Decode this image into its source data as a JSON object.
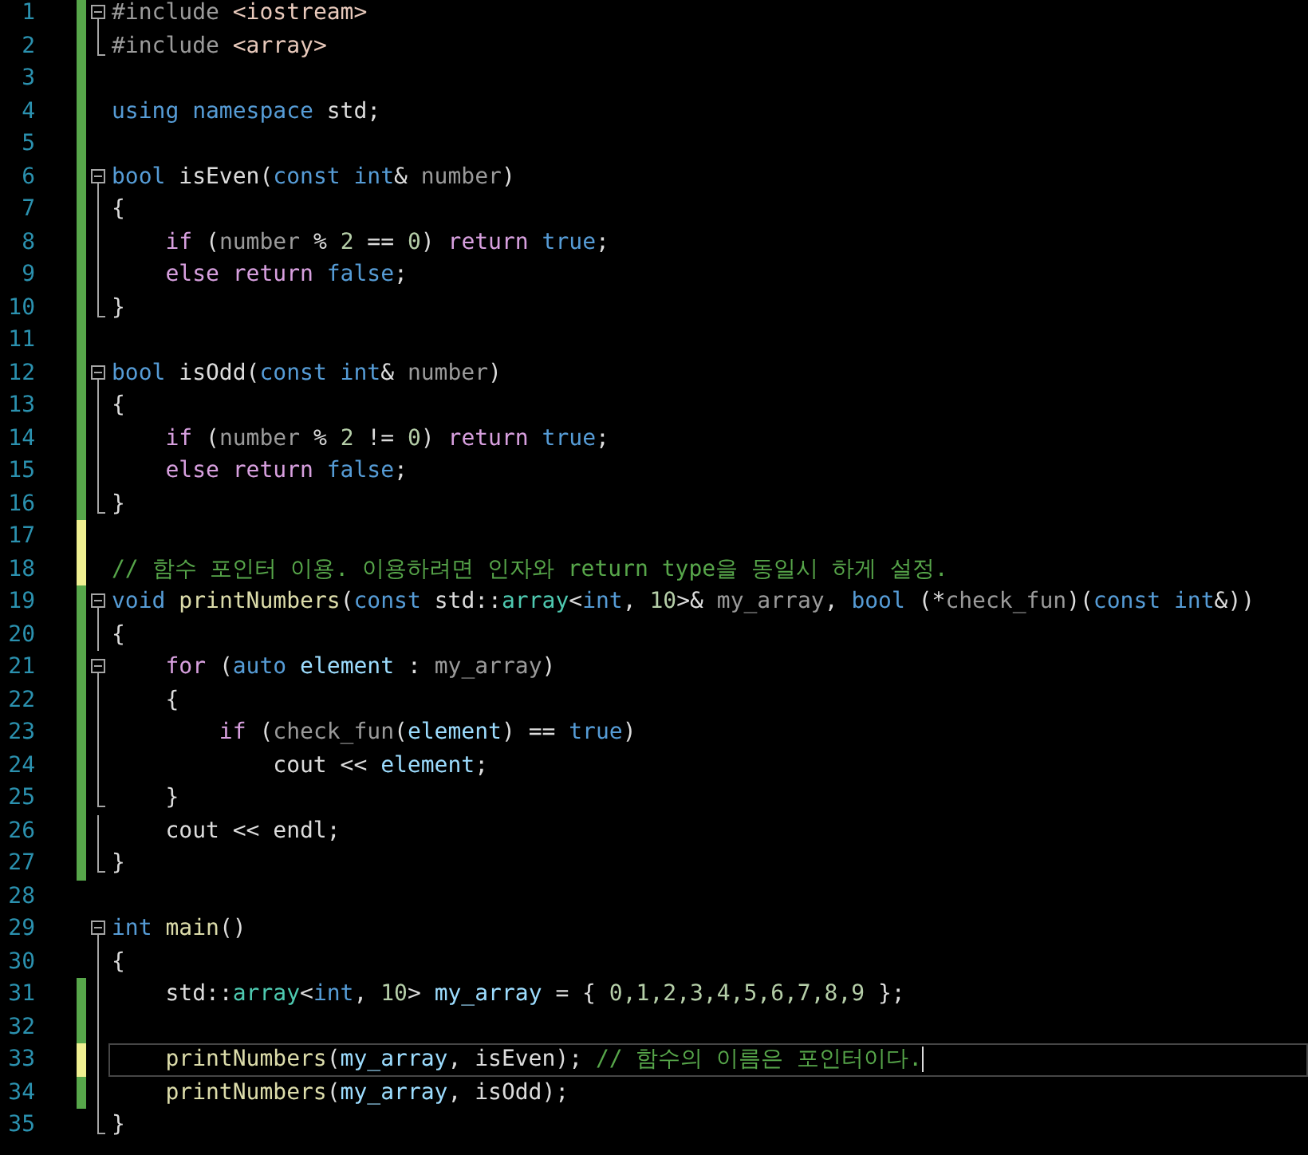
{
  "editor": {
    "lines": [
      {
        "number": "1",
        "color": "#57a64a",
        "kind": "fold-start",
        "current": false,
        "tokens": [
          {
            "text": "#include",
            "kind": "pp"
          },
          {
            "text": " <iostream>",
            "kind": "inc"
          }
        ]
      },
      {
        "number": "2",
        "color": "#57a64a",
        "kind": "fold-end",
        "current": false,
        "tokens": [
          {
            "text": "#include",
            "kind": "pp"
          },
          {
            "text": " <array>",
            "kind": "inc"
          }
        ]
      },
      {
        "number": "3",
        "color": "#57a64a",
        "kind": "plain",
        "current": false
      },
      {
        "number": "4",
        "color": "#57a64a",
        "kind": "plain",
        "current": false,
        "tokens": [
          {
            "text": "using namespace",
            "kind": "kw"
          },
          {
            "text": " std;",
            "kind": "txt"
          }
        ]
      },
      {
        "number": "5",
        "color": "#57a64a",
        "kind": "plain",
        "current": false
      },
      {
        "number": "6",
        "color": "#57a64a",
        "kind": "fold-start",
        "current": false,
        "tokens": [
          {
            "text": "bool",
            "kind": "kw"
          },
          {
            "text": " isEven(",
            "kind": "txt"
          },
          {
            "text": "const int",
            "kind": "kw"
          },
          {
            "text": "& ",
            "kind": "txt"
          },
          {
            "text": "number",
            "kind": "prm"
          },
          {
            "text": ")",
            "kind": "txt"
          }
        ]
      },
      {
        "number": "7",
        "color": "#57a64a",
        "kind": "fold-line",
        "current": false,
        "tokens": [
          {
            "text": "{",
            "kind": "txt"
          }
        ]
      },
      {
        "number": "8",
        "color": "#57a64a",
        "kind": "fold-line",
        "current": false,
        "tokens": [
          {
            "text": "    if",
            "kind": "ctl"
          },
          {
            "text": " (",
            "kind": "txt"
          },
          {
            "text": "number",
            "kind": "prm"
          },
          {
            "text": " % ",
            "kind": "txt"
          },
          {
            "text": "2",
            "kind": "num"
          },
          {
            "text": " == ",
            "kind": "txt"
          },
          {
            "text": "0",
            "kind": "num"
          },
          {
            "text": ") ",
            "kind": "txt"
          },
          {
            "text": "return ",
            "kind": "ctl"
          },
          {
            "text": "true",
            "kind": "kw"
          },
          {
            "text": ";",
            "kind": "txt"
          }
        ]
      },
      {
        "number": "9",
        "color": "#57a64a",
        "kind": "fold-line",
        "current": false,
        "tokens": [
          {
            "text": "    else return ",
            "kind": "ctl"
          },
          {
            "text": "false",
            "kind": "kw"
          },
          {
            "text": ";",
            "kind": "txt"
          }
        ]
      },
      {
        "number": "10",
        "color": "#57a64a",
        "kind": "fold-end",
        "current": false,
        "tokens": [
          {
            "text": "}",
            "kind": "txt"
          }
        ]
      },
      {
        "number": "11",
        "color": "#57a64a",
        "kind": "plain",
        "current": false
      },
      {
        "number": "12",
        "color": "#57a64a",
        "kind": "fold-start",
        "current": false,
        "tokens": [
          {
            "text": "bool",
            "kind": "kw"
          },
          {
            "text": " isOdd(",
            "kind": "txt"
          },
          {
            "text": "const int",
            "kind": "kw"
          },
          {
            "text": "& ",
            "kind": "txt"
          },
          {
            "text": "number",
            "kind": "prm"
          },
          {
            "text": ")",
            "kind": "txt"
          }
        ]
      },
      {
        "number": "13",
        "color": "#57a64a",
        "kind": "fold-line",
        "current": false,
        "tokens": [
          {
            "text": "{",
            "kind": "txt"
          }
        ]
      },
      {
        "number": "14",
        "color": "#57a64a",
        "kind": "fold-line",
        "current": false,
        "tokens": [
          {
            "text": "    if",
            "kind": "ctl"
          },
          {
            "text": " (",
            "kind": "txt"
          },
          {
            "text": "number",
            "kind": "prm"
          },
          {
            "text": " % ",
            "kind": "txt"
          },
          {
            "text": "2",
            "kind": "num"
          },
          {
            "text": " != ",
            "kind": "txt"
          },
          {
            "text": "0",
            "kind": "num"
          },
          {
            "text": ") ",
            "kind": "txt"
          },
          {
            "text": "return ",
            "kind": "ctl"
          },
          {
            "text": "true",
            "kind": "kw"
          },
          {
            "text": ";",
            "kind": "txt"
          }
        ]
      },
      {
        "number": "15",
        "color": "#57a64a",
        "kind": "fold-line",
        "current": false,
        "tokens": [
          {
            "text": "    else return ",
            "kind": "ctl"
          },
          {
            "text": "false",
            "kind": "kw"
          },
          {
            "text": ";",
            "kind": "txt"
          }
        ]
      },
      {
        "number": "16",
        "color": "#57a64a",
        "kind": "fold-end",
        "current": false,
        "tokens": [
          {
            "text": "}",
            "kind": "txt"
          }
        ]
      },
      {
        "number": "17",
        "color": "#efef91",
        "kind": "plain",
        "current": false
      },
      {
        "number": "18",
        "color": "#efef91",
        "kind": "plain",
        "current": false,
        "tokens": [
          {
            "text": "// 함수 포인터 이용. 이용하려면 인자와 return type을 동일시 하게 설정.",
            "kind": "cmt"
          }
        ]
      },
      {
        "number": "19",
        "color": "#57a64a",
        "kind": "fold-start",
        "current": false,
        "tokens": [
          {
            "text": "void ",
            "kind": "kw"
          },
          {
            "text": "printNumbers",
            "kind": "fn"
          },
          {
            "text": "(",
            "kind": "txt"
          },
          {
            "text": "const",
            "kind": "kw"
          },
          {
            "text": " std::",
            "kind": "txt"
          },
          {
            "text": "array",
            "kind": "ty"
          },
          {
            "text": "<",
            "kind": "txt"
          },
          {
            "text": "int",
            "kind": "kw"
          },
          {
            "text": ", ",
            "kind": "txt"
          },
          {
            "text": "10",
            "kind": "num"
          },
          {
            "text": ">& ",
            "kind": "txt"
          },
          {
            "text": "my_array",
            "kind": "prm"
          },
          {
            "text": ", ",
            "kind": "txt"
          },
          {
            "text": "bool",
            "kind": "kw"
          },
          {
            "text": " (*",
            "kind": "txt"
          },
          {
            "text": "check_fun",
            "kind": "prm"
          },
          {
            "text": ")(",
            "kind": "txt"
          },
          {
            "text": "const int",
            "kind": "kw"
          },
          {
            "text": "&))",
            "kind": "txt"
          }
        ]
      },
      {
        "number": "20",
        "color": "#57a64a",
        "kind": "fold-line",
        "current": false,
        "tokens": [
          {
            "text": "{",
            "kind": "txt"
          }
        ]
      },
      {
        "number": "21",
        "color": "#57a64a",
        "kind": "fold-start",
        "current": false,
        "tokens": [
          {
            "text": "    for",
            "kind": "ctl"
          },
          {
            "text": " (",
            "kind": "txt"
          },
          {
            "text": "auto ",
            "kind": "kw"
          },
          {
            "text": "element",
            "kind": "var"
          },
          {
            "text": " : ",
            "kind": "txt"
          },
          {
            "text": "my_array",
            "kind": "prm"
          },
          {
            "text": ")",
            "kind": "txt"
          }
        ]
      },
      {
        "number": "22",
        "color": "#57a64a",
        "kind": "fold-line",
        "current": false,
        "tokens": [
          {
            "text": "    {",
            "kind": "txt"
          }
        ]
      },
      {
        "number": "23",
        "color": "#57a64a",
        "kind": "fold-line",
        "current": false,
        "tokens": [
          {
            "text": "        if",
            "kind": "ctl"
          },
          {
            "text": " (",
            "kind": "txt"
          },
          {
            "text": "check_fun",
            "kind": "prm"
          },
          {
            "text": "(",
            "kind": "txt"
          },
          {
            "text": "element",
            "kind": "var"
          },
          {
            "text": ") == ",
            "kind": "txt"
          },
          {
            "text": "true",
            "kind": "kw"
          },
          {
            "text": ")",
            "kind": "txt"
          }
        ]
      },
      {
        "number": "24",
        "color": "#57a64a",
        "kind": "fold-line",
        "current": false,
        "tokens": [
          {
            "text": "            cout << ",
            "kind": "txt"
          },
          {
            "text": "element",
            "kind": "var"
          },
          {
            "text": ";",
            "kind": "txt"
          }
        ]
      },
      {
        "number": "25",
        "color": "#57a64a",
        "kind": "fold-end",
        "current": false,
        "tokens": [
          {
            "text": "    }",
            "kind": "txt"
          }
        ]
      },
      {
        "number": "26",
        "color": "#57a64a",
        "kind": "fold-line",
        "current": false,
        "tokens": [
          {
            "text": "    cout << endl;",
            "kind": "txt"
          }
        ]
      },
      {
        "number": "27",
        "color": "#57a64a",
        "kind": "fold-end",
        "current": false,
        "tokens": [
          {
            "text": "}",
            "kind": "txt"
          }
        ]
      },
      {
        "number": "28",
        "kind": "plain",
        "current": false
      },
      {
        "number": "29",
        "kind": "fold-start",
        "current": false,
        "tokens": [
          {
            "text": "int ",
            "kind": "kw"
          },
          {
            "text": "main",
            "kind": "fn"
          },
          {
            "text": "()",
            "kind": "txt"
          }
        ]
      },
      {
        "number": "30",
        "kind": "fold-line",
        "current": false,
        "tokens": [
          {
            "text": "{",
            "kind": "txt"
          }
        ]
      },
      {
        "number": "31",
        "color": "#57a64a",
        "kind": "fold-line",
        "current": false,
        "tokens": [
          {
            "text": "    std::",
            "kind": "txt"
          },
          {
            "text": "array",
            "kind": "ty"
          },
          {
            "text": "<",
            "kind": "txt"
          },
          {
            "text": "int",
            "kind": "kw"
          },
          {
            "text": ", ",
            "kind": "txt"
          },
          {
            "text": "10",
            "kind": "num"
          },
          {
            "text": "> ",
            "kind": "txt"
          },
          {
            "text": "my_array",
            "kind": "var"
          },
          {
            "text": " = { ",
            "kind": "txt"
          },
          {
            "text": "0,1,2,3,4,5,6,7,8,9",
            "kind": "num"
          },
          {
            "text": " };",
            "kind": "txt"
          }
        ]
      },
      {
        "number": "32",
        "color": "#57a64a",
        "kind": "fold-line",
        "current": false
      },
      {
        "number": "33",
        "color": "#efef91",
        "kind": "fold-line",
        "current": true,
        "tokens": [
          {
            "text": "    printNumbers",
            "kind": "fn"
          },
          {
            "text": "(",
            "kind": "txt"
          },
          {
            "text": "my_array",
            "kind": "var"
          },
          {
            "text": ", isEven); ",
            "kind": "txt"
          },
          {
            "text": "// 함수의 이름은 포인터이다.",
            "kind": "cmt"
          }
        ]
      },
      {
        "number": "34",
        "color": "#57a64a",
        "kind": "fold-line",
        "current": false,
        "tokens": [
          {
            "text": "    printNumbers",
            "kind": "fn"
          },
          {
            "text": "(",
            "kind": "txt"
          },
          {
            "text": "my_array",
            "kind": "var"
          },
          {
            "text": ", isOdd);",
            "kind": "txt"
          }
        ]
      },
      {
        "number": "35",
        "kind": "fold-end",
        "current": false,
        "tokens": [
          {
            "text": "}",
            "kind": "txt"
          }
        ]
      }
    ]
  }
}
